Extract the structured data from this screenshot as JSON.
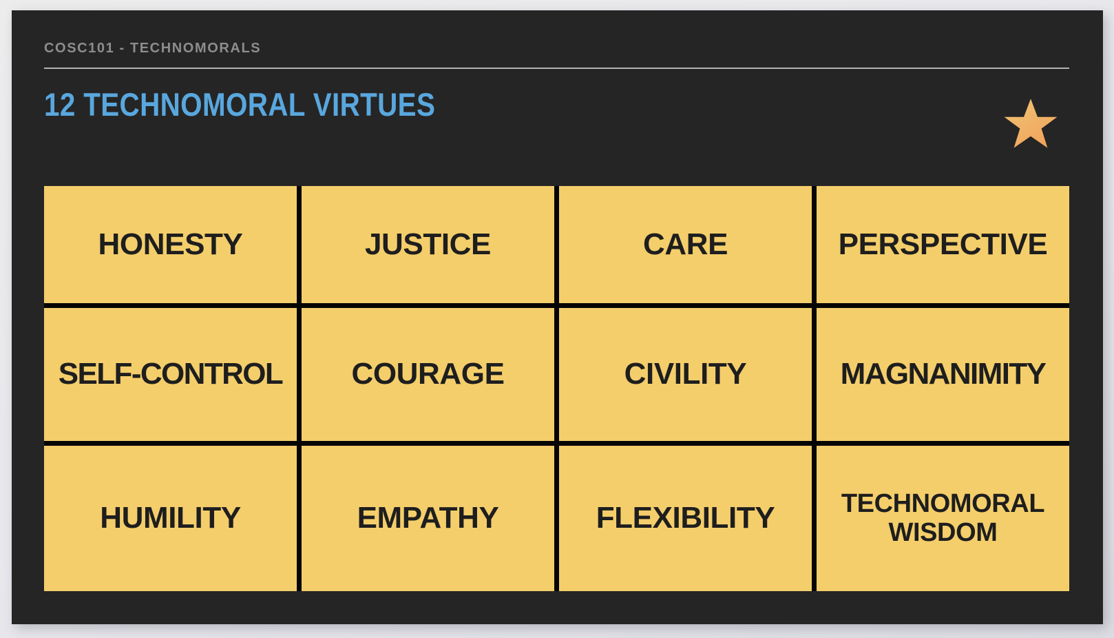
{
  "slide": {
    "course_label": "COSC101 - TECHNOMORALS",
    "title": "12 TECHNOMORAL VIRTUES",
    "badge_icon": "star-icon",
    "colors": {
      "page_background": "#e9e9ee",
      "card_background": "#252525",
      "title_accent": "#59a7de",
      "course_label": "#8d8d8d",
      "divider": "#b4b4b4",
      "cell_background": "#f4ce6b",
      "cell_text": "#1e1e1e",
      "grid_line": "#050505",
      "star_gradient_start": "#f0bb6a",
      "star_gradient_end": "#f3a95f"
    }
  },
  "virtues": [
    {
      "label": "HONESTY",
      "wrap": false
    },
    {
      "label": "JUSTICE",
      "wrap": false
    },
    {
      "label": "CARE",
      "wrap": false
    },
    {
      "label": "PERSPECTIVE",
      "wrap": false
    },
    {
      "label": "SELF-CONTROL",
      "wrap": false
    },
    {
      "label": "COURAGE",
      "wrap": false
    },
    {
      "label": "CIVILITY",
      "wrap": false
    },
    {
      "label": "MAGNANIMITY",
      "wrap": false
    },
    {
      "label": "HUMILITY",
      "wrap": false
    },
    {
      "label": "EMPATHY",
      "wrap": false
    },
    {
      "label": "FLEXIBILITY",
      "wrap": false
    },
    {
      "label": "TECHNOMORAL WISDOM",
      "wrap": true
    }
  ]
}
